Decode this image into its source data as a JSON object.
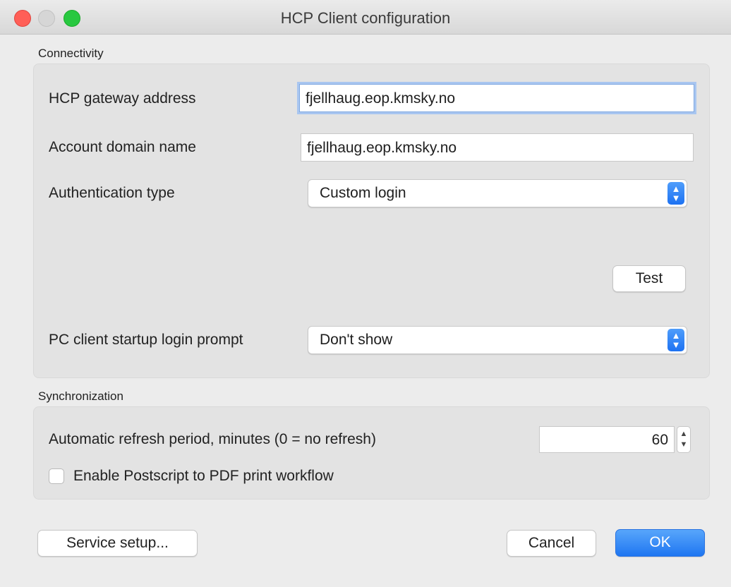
{
  "window": {
    "title": "HCP Client configuration"
  },
  "connectivity": {
    "section_label": "Connectivity",
    "gateway_label": "HCP gateway address",
    "gateway_value": "fjellhaug.eop.kmsky.no",
    "domain_label": "Account domain name",
    "domain_value": "fjellhaug.eop.kmsky.no",
    "auth_label": "Authentication type",
    "auth_value": "Custom login",
    "test_button": "Test",
    "prompt_label": "PC client startup login prompt",
    "prompt_value": "Don't show"
  },
  "synchronization": {
    "section_label": "Synchronization",
    "refresh_label": "Automatic refresh period, minutes (0 = no refresh)",
    "refresh_value": "60",
    "postscript_label": "Enable Postscript to PDF print workflow",
    "postscript_checked": false
  },
  "footer": {
    "service_setup": "Service setup...",
    "cancel": "Cancel",
    "ok": "OK"
  },
  "colors": {
    "accent": "#1f76f1",
    "close": "#ff5f57",
    "maximize": "#28c840"
  }
}
